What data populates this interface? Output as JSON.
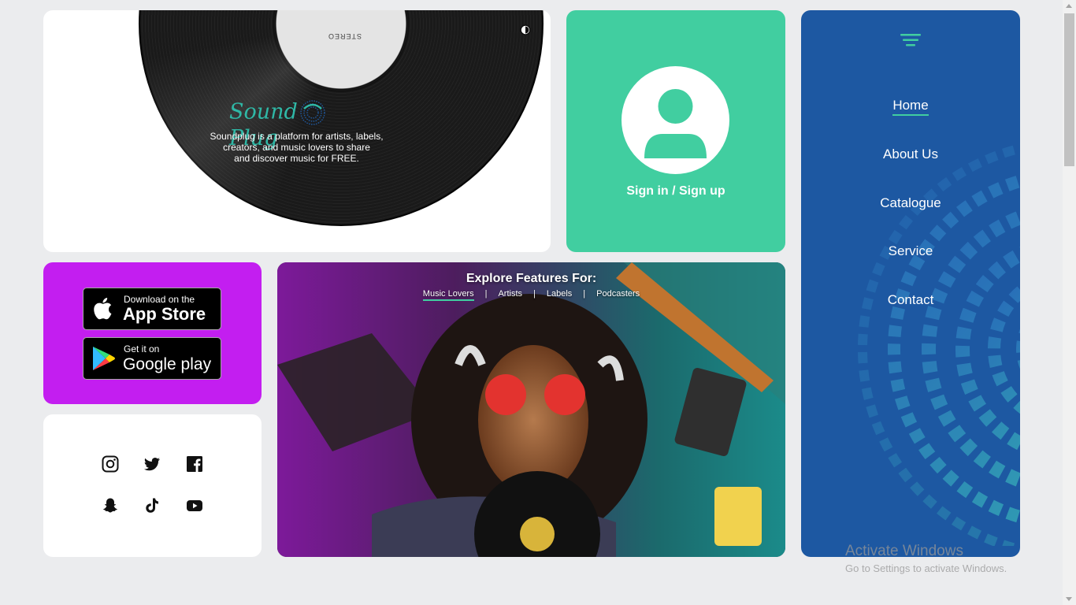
{
  "hero": {
    "logo_left": "Sound",
    "logo_right": "Plug",
    "tagline_lines": [
      "Soundplug is a platform for artists, labels,",
      "creators, and music lovers to share",
      "and discover music for FREE."
    ],
    "record_label_text": "STEREO",
    "theme_toggle_icon": "contrast-icon"
  },
  "signin": {
    "label": "Sign in / Sign up",
    "icon": "user-avatar-icon"
  },
  "nav": {
    "menu_icon": "hamburger-menu-icon",
    "items": [
      {
        "label": "Home",
        "active": true
      },
      {
        "label": "About Us",
        "active": false
      },
      {
        "label": "Catalogue",
        "active": false
      },
      {
        "label": "Service",
        "active": false
      },
      {
        "label": "Contact",
        "active": false
      }
    ]
  },
  "apps": {
    "app_store": {
      "small": "Download on the",
      "big": "App Store",
      "icon": "apple-icon"
    },
    "google_play": {
      "small": "Get it on",
      "big": "Google play",
      "icon": "google-play-icon"
    }
  },
  "social": {
    "icons": [
      "instagram-icon",
      "twitter-icon",
      "facebook-icon",
      "snapchat-icon",
      "tiktok-icon",
      "youtube-icon"
    ]
  },
  "features": {
    "title": "Explore Features For:",
    "tabs": [
      {
        "label": "Music Lovers",
        "active": true
      },
      {
        "label": "Artists",
        "active": false
      },
      {
        "label": "Labels",
        "active": false
      },
      {
        "label": "Podcasters",
        "active": false
      }
    ],
    "separator": "|"
  },
  "watermark": {
    "title": "Activate Windows",
    "subtitle": "Go to Settings to activate Windows."
  },
  "colors": {
    "page_bg": "#ebecee",
    "signin_green": "#41cea0",
    "nav_blue": "#1d58a2",
    "apps_purple": "#c31ef0",
    "logo_teal": "#2fb8a6"
  }
}
